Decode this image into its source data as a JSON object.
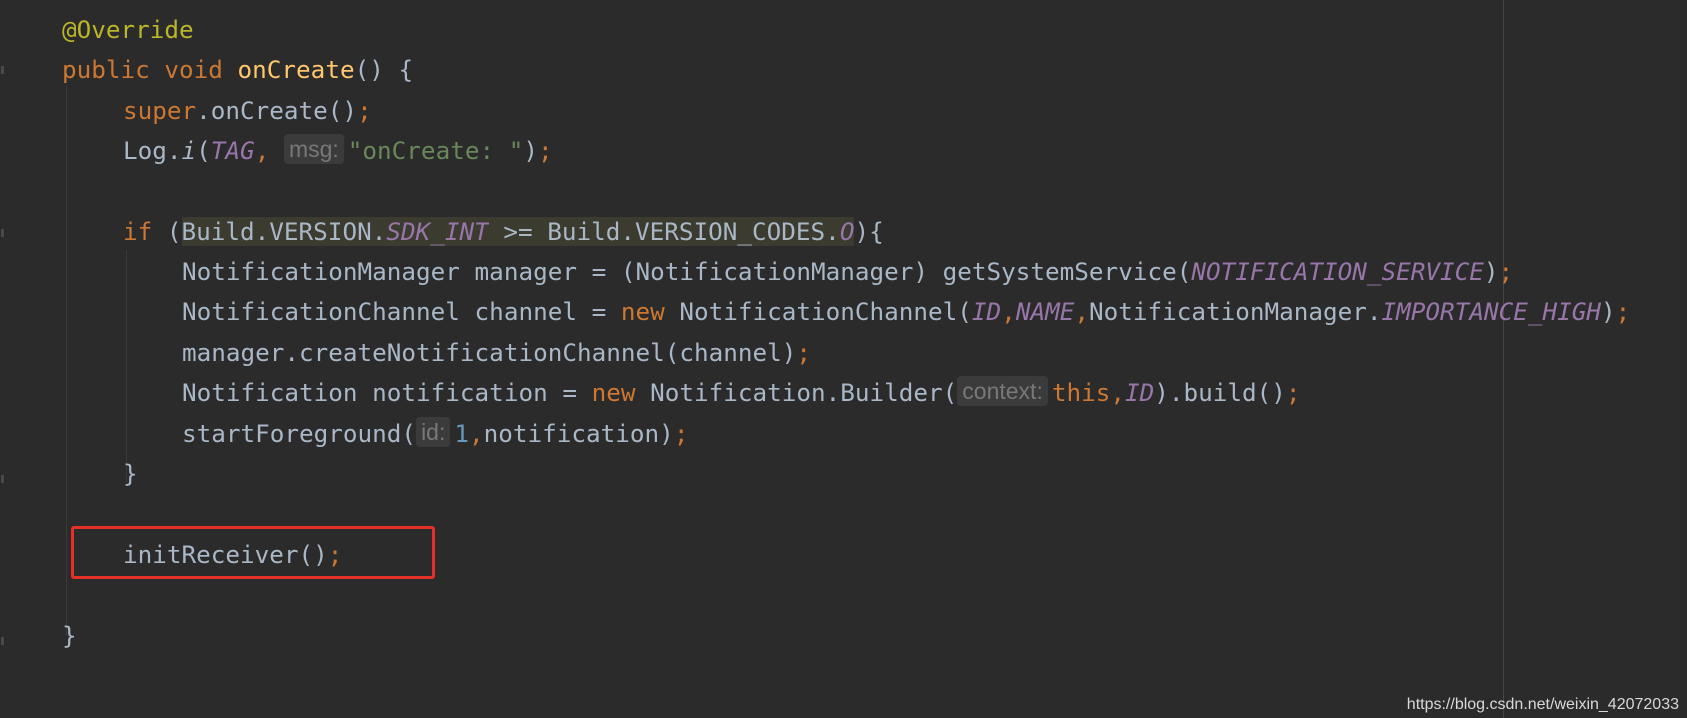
{
  "editor": {
    "lines": [
      {
        "tokens": [
          {
            "t": "@Override",
            "c": "ann"
          }
        ]
      },
      {
        "tokens": [
          {
            "t": "public void ",
            "c": "kw"
          },
          {
            "t": "onCreate",
            "c": "fn"
          },
          {
            "t": "() {",
            "c": ""
          }
        ]
      },
      {
        "tokens": [
          {
            "t": "super",
            "c": "kw"
          },
          {
            "t": ".onCreate()",
            "c": ""
          },
          {
            "t": ";",
            "c": "kw"
          }
        ]
      },
      {
        "tokens": [
          {
            "t": "Log.",
            "c": ""
          },
          {
            "t": "i",
            "c": "const-i"
          },
          {
            "t": "(",
            "c": ""
          },
          {
            "t": "TAG",
            "c": "const"
          },
          {
            "t": ", ",
            "c": "kw"
          },
          {
            "t": "msg:",
            "c": "hint"
          },
          {
            "t": "\"onCreate: \"",
            "c": "str"
          },
          {
            "t": ")",
            "c": ""
          },
          {
            "t": ";",
            "c": "kw"
          }
        ]
      },
      {
        "tokens": []
      },
      {
        "tokens": [
          {
            "t": "if ",
            "c": "kw"
          },
          {
            "t": "(",
            "c": ""
          },
          {
            "t": "Build.VERSION.",
            "c": "hl"
          },
          {
            "t": "SDK_INT",
            "c": "hl-const"
          },
          {
            "t": " >= Build.VERSION_CODES.",
            "c": "hl"
          },
          {
            "t": "O",
            "c": "hl-const"
          },
          {
            "t": "){",
            "c": ""
          }
        ]
      },
      {
        "tokens": [
          {
            "t": "NotificationManager manager = (NotificationManager) getSystemService(",
            "c": ""
          },
          {
            "t": "NOTIFICATION_SERVICE",
            "c": "const"
          },
          {
            "t": ")",
            "c": ""
          },
          {
            "t": ";",
            "c": "kw"
          }
        ]
      },
      {
        "tokens": [
          {
            "t": "NotificationChannel channel = ",
            "c": ""
          },
          {
            "t": "new ",
            "c": "kw"
          },
          {
            "t": "NotificationChannel(",
            "c": ""
          },
          {
            "t": "ID",
            "c": "const"
          },
          {
            "t": ",",
            "c": "kw"
          },
          {
            "t": "NAME",
            "c": "const"
          },
          {
            "t": ",",
            "c": "kw"
          },
          {
            "t": "NotificationManager.",
            "c": ""
          },
          {
            "t": "IMPORTANCE_HIGH",
            "c": "const"
          },
          {
            "t": ")",
            "c": ""
          },
          {
            "t": ";",
            "c": "kw"
          }
        ]
      },
      {
        "tokens": [
          {
            "t": "manager.createNotificationChannel(channel)",
            "c": ""
          },
          {
            "t": ";",
            "c": "kw"
          }
        ]
      },
      {
        "tokens": [
          {
            "t": "Notification notification = ",
            "c": ""
          },
          {
            "t": "new ",
            "c": "kw"
          },
          {
            "t": "Notification.Builder(",
            "c": ""
          },
          {
            "t": "context:",
            "c": "hint"
          },
          {
            "t": "this",
            "c": "kw"
          },
          {
            "t": ",",
            "c": "kw"
          },
          {
            "t": "ID",
            "c": "const"
          },
          {
            "t": ").build()",
            "c": ""
          },
          {
            "t": ";",
            "c": "kw"
          }
        ]
      },
      {
        "tokens": [
          {
            "t": "startForeground(",
            "c": ""
          },
          {
            "t": "id:",
            "c": "hint"
          },
          {
            "t": "1",
            "c": "num"
          },
          {
            "t": ",",
            "c": "kw"
          },
          {
            "t": "notification)",
            "c": ""
          },
          {
            "t": ";",
            "c": "kw"
          }
        ]
      },
      {
        "tokens": [
          {
            "t": "}",
            "c": ""
          }
        ]
      },
      {
        "tokens": []
      },
      {
        "tokens": [
          {
            "t": "initReceiver()",
            "c": ""
          },
          {
            "t": ";",
            "c": "kw"
          }
        ]
      },
      {
        "tokens": []
      },
      {
        "tokens": [
          {
            "t": "}",
            "c": ""
          }
        ]
      }
    ]
  },
  "watermark": "https://blog.csdn.net/weixin_42072033",
  "colors": {
    "background": "#2b2b2b",
    "keyword": "#cc7832",
    "annotation": "#bbb529",
    "method": "#ffc66d",
    "constant": "#9876aa",
    "string": "#6a8759",
    "number": "#6897bb",
    "highlight_box": "#e5302a"
  }
}
